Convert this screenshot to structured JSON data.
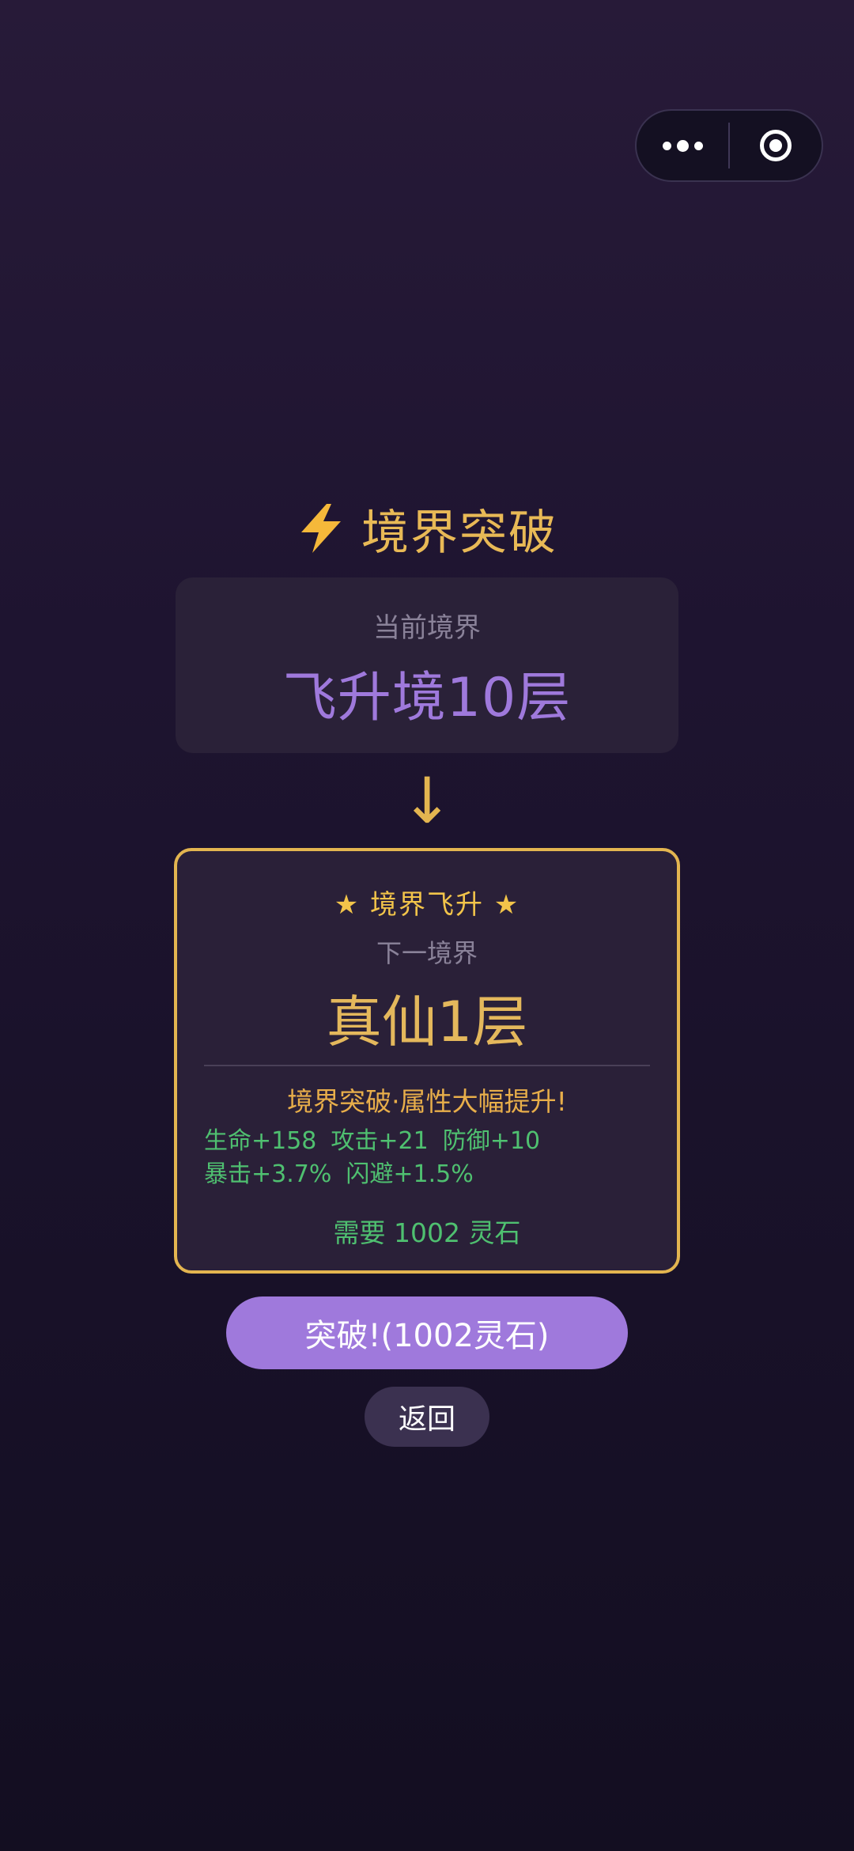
{
  "capsule": {
    "more_icon": "more-dots-icon",
    "close_icon": "target-circle-icon"
  },
  "title": {
    "icon": "lightning-bolt-icon",
    "text": "境界突破"
  },
  "current": {
    "label": "当前境界",
    "realm": "飞升境10层"
  },
  "arrow": "↓",
  "next": {
    "badge": "★ 境界飞升 ★",
    "label": "下一境界",
    "realm": "真仙1层",
    "boost_text": "境界突破·属性大幅提升!",
    "stats": [
      "生命+158",
      "攻击+21",
      "防御+10",
      "暴击+3.7%",
      "闪避+1.5%"
    ],
    "cost": "需要 1002 灵石"
  },
  "buttons": {
    "breakthrough": "突破!(1002灵石)",
    "back": "返回"
  },
  "colors": {
    "gold": "#e3b550",
    "purple": "#9f79dc",
    "green": "#4fc070"
  }
}
